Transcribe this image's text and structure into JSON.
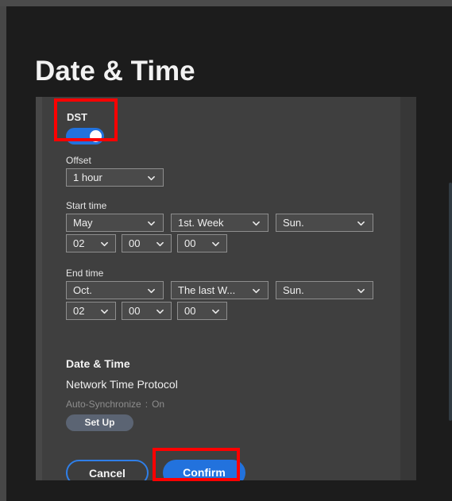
{
  "page": {
    "title": "Date & Time",
    "accent_color": "#2272dd",
    "highlight_color": "#fe0000",
    "panel_bg": "#3f3f3f",
    "background": "#1c1c1c"
  },
  "dst": {
    "label": "DST",
    "toggle_state": "on",
    "toggle_icon": "toggle-on-icon"
  },
  "offset": {
    "label": "Offset",
    "value": "1 hour"
  },
  "start_time": {
    "label": "Start time",
    "month": "May",
    "week": "1st. Week",
    "day": "Sun.",
    "hour": "02",
    "minute": "00",
    "second": "00"
  },
  "end_time": {
    "label": "End time",
    "month": "Oct.",
    "week": "The last W...",
    "day": "Sun.",
    "hour": "02",
    "minute": "00",
    "second": "00"
  },
  "datetime_section": {
    "section_title": "Date & Time",
    "ntp_title": "Network Time Protocol",
    "auto_sync_label": "Auto-Synchronize",
    "auto_sync_separator": ":",
    "auto_sync_value": "On",
    "setup_button": "Set Up"
  },
  "footer": {
    "cancel_label": "Cancel",
    "confirm_label": "Confirm"
  },
  "icons": {
    "caret_down": "chevron-down-icon"
  }
}
